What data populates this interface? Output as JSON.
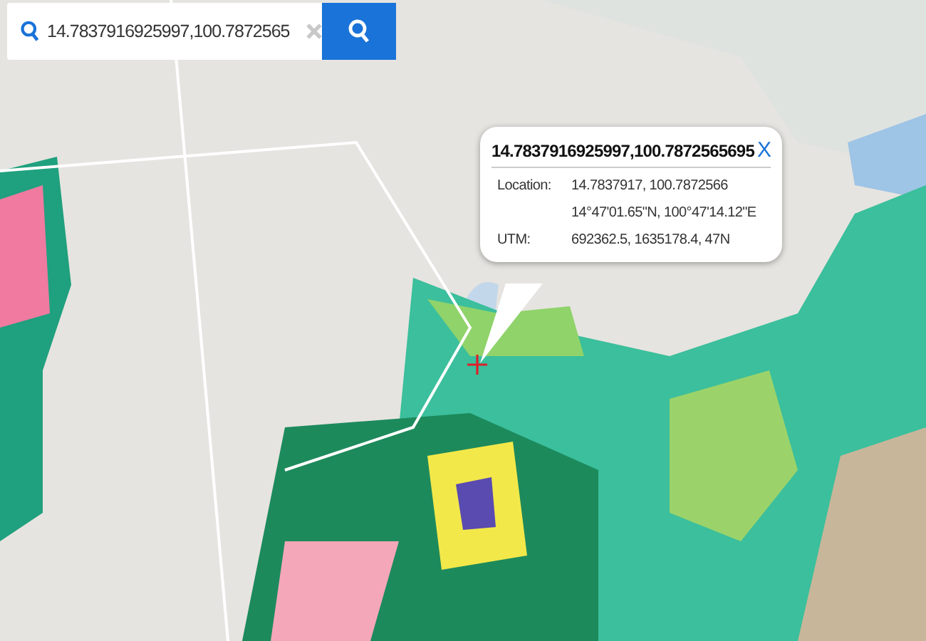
{
  "search": {
    "value": "14.7837916925997,100.7872565"
  },
  "popup": {
    "title": "14.7837916925997,100.7872565695",
    "close": "X",
    "rows": [
      {
        "label": "Location:",
        "value": "14.7837917, 100.7872566"
      },
      {
        "value": "14°47'01.65\"N, 100°47'14.12\"E"
      },
      {
        "label": "UTM:",
        "value": "692362.5, 1635178.4, 47N"
      }
    ]
  }
}
